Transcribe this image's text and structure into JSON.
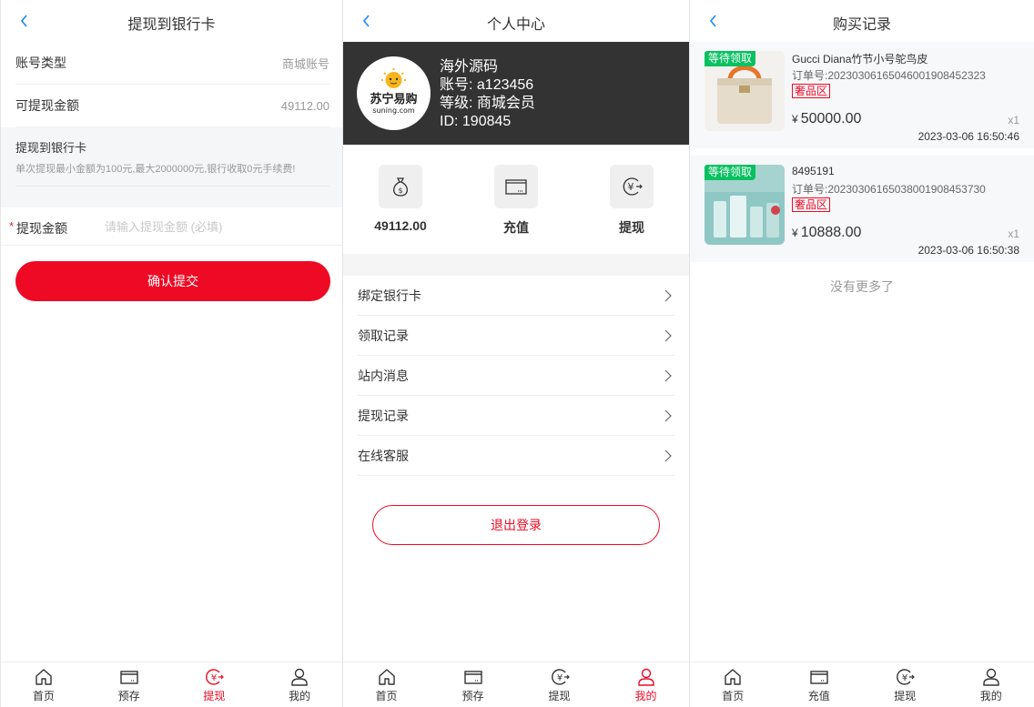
{
  "withdraw": {
    "title": "提现到银行卡",
    "account_type_label": "账号类型",
    "account_type_value": "商城账号",
    "available_label": "可提现金额",
    "available_value": "49112.00",
    "info_title": "提现到银行卡",
    "info_desc": "单次提现最小金额为100元,最大2000000元,银行收取0元手续费!",
    "amount_required_mark": "*",
    "amount_label": "提现金额",
    "amount_placeholder": "请输入提现金额 (必填)",
    "amount_value": "",
    "submit_label": "确认提交",
    "tabs": [
      {
        "label": "首页",
        "icon": "home-icon"
      },
      {
        "label": "预存",
        "icon": "card-icon"
      },
      {
        "label": "提现",
        "icon": "withdraw-icon"
      },
      {
        "label": "我的",
        "icon": "user-icon"
      }
    ],
    "active_tab": 2
  },
  "profile": {
    "title": "个人中心",
    "avatar_brand": "苏宁易购",
    "avatar_sub": "suning.com",
    "name": "海外源码",
    "account": "账号: a123456",
    "level": "等级: 商城会员",
    "id": "ID: 190845",
    "quick": [
      {
        "label": "49112.00",
        "icon": "money-bag-icon"
      },
      {
        "label": "充值",
        "icon": "card-icon"
      },
      {
        "label": "提现",
        "icon": "withdraw-icon"
      }
    ],
    "menu": [
      {
        "label": "绑定银行卡"
      },
      {
        "label": "领取记录"
      },
      {
        "label": "站内消息"
      },
      {
        "label": "提现记录"
      },
      {
        "label": "在线客服"
      }
    ],
    "logout_label": "退出登录",
    "tabs": [
      {
        "label": "首页",
        "icon": "home-icon"
      },
      {
        "label": "预存",
        "icon": "card-icon"
      },
      {
        "label": "提现",
        "icon": "withdraw-icon"
      },
      {
        "label": "我的",
        "icon": "user-icon"
      }
    ],
    "active_tab": 3
  },
  "orders": {
    "title": "购买记录",
    "items": [
      {
        "tag": "等待领取",
        "name": "Gucci Diana竹节小号鸵鸟皮",
        "order_no": "订单号:20230306165046001908452323",
        "badge": "奢品区",
        "currency": "¥",
        "price": "50000.00",
        "qty": "x1",
        "time": "2023-03-06 16:50:46"
      },
      {
        "tag": "等待领取",
        "name": "8495191",
        "order_no": "订单号:20230306165038001908453730",
        "badge": "奢品区",
        "currency": "¥",
        "price": "10888.00",
        "qty": "x1",
        "time": "2023-03-06 16:50:38"
      }
    ],
    "no_more": "没有更多了",
    "tabs": [
      {
        "label": "首页",
        "icon": "home-icon"
      },
      {
        "label": "充值",
        "icon": "card-icon"
      },
      {
        "label": "提现",
        "icon": "withdraw-icon"
      },
      {
        "label": "我的",
        "icon": "user-icon"
      }
    ],
    "active_tab": -1
  },
  "colors": {
    "accent": "#ee0a24",
    "tag_green": "#07c160",
    "hero_bg": "#333333"
  }
}
